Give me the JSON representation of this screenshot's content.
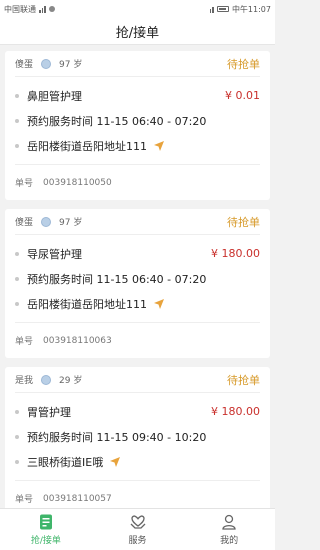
{
  "status_bar": {
    "carrier": "中国联通",
    "time": "中午11:07"
  },
  "title": "抢/接单",
  "orders": [
    {
      "name": "傻蛋",
      "age": "97 岁",
      "status": "待抢单",
      "service": "鼻胆管护理",
      "price": "¥ 0.01",
      "appointment": "预约服务时间  11-15  06:40 - 07:20",
      "address": "岳阳楼街道岳阳地址111",
      "order_label": "单号",
      "order_no": "003918110050"
    },
    {
      "name": "傻蛋",
      "age": "97 岁",
      "status": "待抢单",
      "service": "导尿管护理",
      "price": "¥ 180.00",
      "appointment": "预约服务时间  11-15  06:40 - 07:20",
      "address": "岳阳楼街道岳阳地址111",
      "order_label": "单号",
      "order_no": "003918110063"
    },
    {
      "name": "是我",
      "age": "29 岁",
      "status": "待抢单",
      "service": "胃管护理",
      "price": "¥ 180.00",
      "appointment": "预约服务时间  11-15  09:40 - 10:20",
      "address": "三眼桥街道IE哦",
      "order_label": "单号",
      "order_no": "003918110057"
    }
  ],
  "tabs": [
    {
      "label": "抢/接单",
      "icon": "document-icon",
      "active": true
    },
    {
      "label": "服务",
      "icon": "heart-hands-icon",
      "active": false
    },
    {
      "label": "我的",
      "icon": "user-icon",
      "active": false
    }
  ],
  "colors": {
    "accent": "#3fb56a",
    "status": "#d79a2a",
    "price": "#c9302c"
  }
}
